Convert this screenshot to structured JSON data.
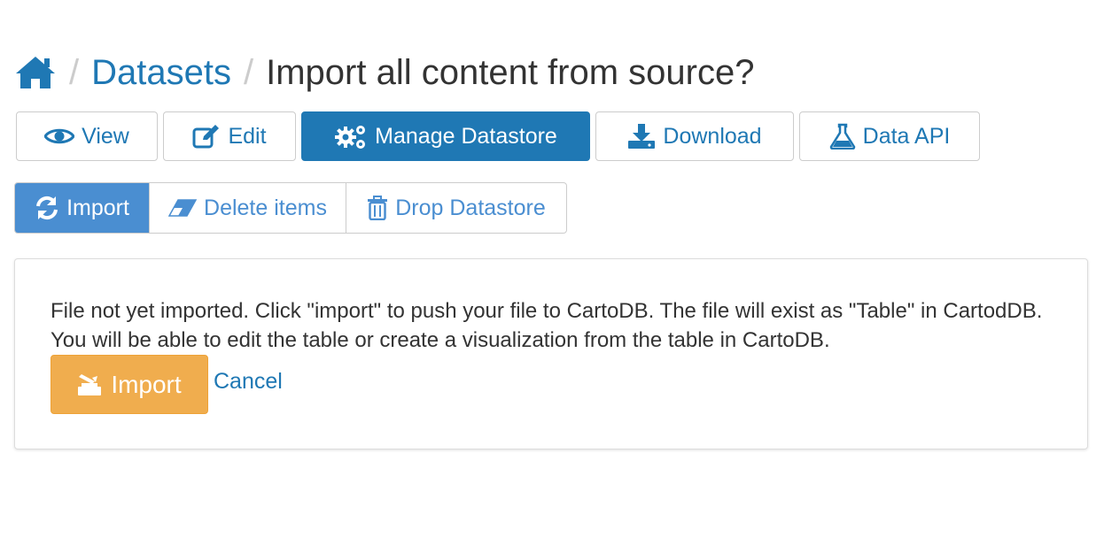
{
  "breadcrumb": {
    "home_icon": "home-icon",
    "separator": "/",
    "datasets_label": "Datasets",
    "current_label": "Import all content from source?"
  },
  "nav": {
    "view_label": "View",
    "edit_label": "Edit",
    "manage_datastore_label": "Manage Datastore",
    "download_label": "Download",
    "data_api_label": "Data API",
    "active": "Manage Datastore",
    "icons": [
      "eye-icon",
      "edit-icon",
      "gears-icon",
      "download-icon",
      "flask-icon"
    ]
  },
  "subnav": {
    "import_label": "Import",
    "delete_items_label": "Delete items",
    "drop_datastore_label": "Drop Datastore",
    "active": "Import",
    "icons": [
      "refresh-icon",
      "eraser-icon",
      "trash-icon"
    ]
  },
  "panel": {
    "message": "File not yet imported. Click \"import\" to push your file to CartoDB. The file will exist as \"Table\" in CartodDB. You will be able to edit the table or create a visualization from the table in CartoDB.",
    "import_button_label": "Import",
    "cancel_label": "Cancel"
  },
  "colors": {
    "link": "#1f78b4",
    "active_nav": "#1f78b4",
    "active_subnav": "#4a8ed1",
    "warning_button": "#f0ad4e"
  }
}
